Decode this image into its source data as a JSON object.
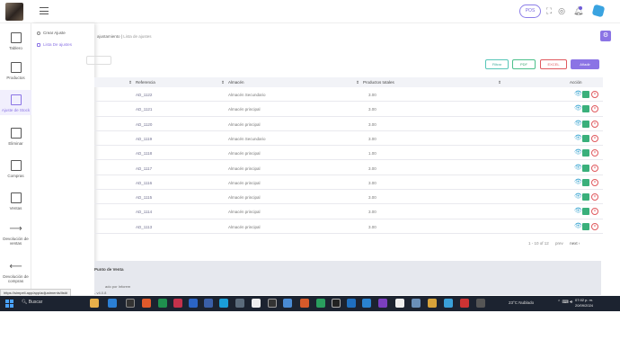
{
  "header": {
    "pos_label": "POS"
  },
  "sidebar": {
    "items": [
      {
        "label": "Tablero"
      },
      {
        "label": "Productos"
      },
      {
        "label": "Ajuste de Stock"
      },
      {
        "label": "Eliminar"
      },
      {
        "label": "Compras"
      },
      {
        "label": "Ventas"
      },
      {
        "label": "Devolución de ventas"
      },
      {
        "label": "Devolución de compras"
      }
    ]
  },
  "flyout": {
    "items": [
      {
        "label": "Crear Ajuste"
      },
      {
        "label": "Lista De ajustes"
      }
    ]
  },
  "breadcrumb": {
    "parent": "ajustamiento",
    "separator": "|",
    "current": "Lista de ajustes"
  },
  "actions": {
    "filter": "Filtrar",
    "pdf": "PDF",
    "excel": "EXCEL",
    "create": "Añadir"
  },
  "table": {
    "headers": {
      "reference": "Referencia",
      "warehouse": "Almacén",
      "products": "Productos totales",
      "action": "Acción"
    },
    "rows": [
      {
        "ref": "AD_1122",
        "warehouse": "Almacén Secundario",
        "qty": "3.00"
      },
      {
        "ref": "AD_1121",
        "warehouse": "Almacén principal",
        "qty": "3.00"
      },
      {
        "ref": "AD_1120",
        "warehouse": "Almacén principal",
        "qty": "3.00"
      },
      {
        "ref": "AD_1119",
        "warehouse": "Almacén Secundario",
        "qty": "3.00"
      },
      {
        "ref": "AD_1118",
        "warehouse": "Almacén principal",
        "qty": "1.00"
      },
      {
        "ref": "AD_1117",
        "warehouse": "Almacén principal",
        "qty": "3.00"
      },
      {
        "ref": "AD_1116",
        "warehouse": "Almacén principal",
        "qty": "3.00"
      },
      {
        "ref": "AD_1115",
        "warehouse": "Almacén principal",
        "qty": "3.00"
      },
      {
        "ref": "AD_1114",
        "warehouse": "Almacén principal",
        "qty": "3.00"
      },
      {
        "ref": "AD_1113",
        "warehouse": "Almacén principal",
        "qty": "3.00"
      }
    ]
  },
  "pagination": {
    "range": "1 - 10 of 12",
    "prev": "prev",
    "next": "next"
  },
  "panel": {
    "title": "Punto de Venta",
    "subtitle": "ado por Inforem",
    "version": "- v4.0.8"
  },
  "status_url": "https://simpeli.app/app/adjustments/list#",
  "taskbar": {
    "search": "Buscar",
    "weather": "23°C Nublado",
    "time": "07:02 p. m.",
    "date": "20/09/2024"
  },
  "colors": {
    "accent": "#8b74e5",
    "edit": "#3ab07b",
    "delete": "#e0595e",
    "view": "#43a9d3"
  }
}
